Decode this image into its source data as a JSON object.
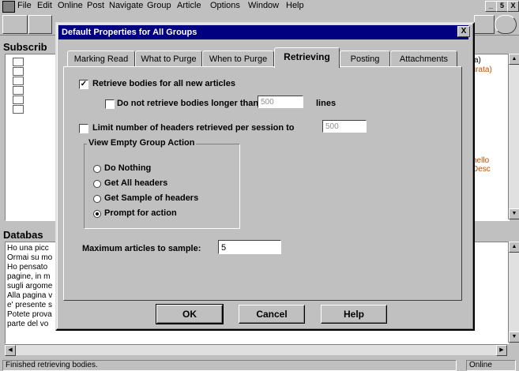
{
  "menu": [
    "File",
    "Edit",
    "Online",
    "Post",
    "Navigate",
    "Group",
    "Article",
    "Options",
    "Window",
    "Help"
  ],
  "window_controls": {
    "minimize": "_",
    "restore": "5",
    "close": "X"
  },
  "subscribe_pane": {
    "title": "Subscrib"
  },
  "right_fragments": {
    "a": "a)",
    "b": "irata)",
    "c": "hello Desc"
  },
  "database_pane": {
    "title": "Databas",
    "lines": [
      "Ho una picc",
      "Ormai su mo",
      "Ho pensato",
      "pagine, in m",
      "sugli argome",
      "Alla pagina v",
      "e' presente s",
      "Potete prova",
      "parte del vo"
    ]
  },
  "status": {
    "message": "Finished retrieving bodies.",
    "mode": "Online"
  },
  "dialog": {
    "title": "Default Properties for All Groups",
    "close": "X",
    "tabs": [
      "Marking Read",
      "What to Purge",
      "When to Purge",
      "Retrieving",
      "Posting",
      "Attachments"
    ],
    "active_tab": "Retrieving",
    "retrieve_bodies": {
      "label": "Retrieve bodies for all new articles",
      "checked": true
    },
    "no_retrieve_longer": {
      "label": "Do not retrieve bodies longer than",
      "value": "500",
      "suffix": "lines",
      "checked": false
    },
    "limit_headers": {
      "label": "Limit number of headers retrieved per session to",
      "value": "500",
      "checked": false
    },
    "empty_group_action": {
      "title": "View Empty Group Action",
      "options": [
        "Do Nothing",
        "Get All headers",
        "Get Sample of headers",
        "Prompt for action"
      ],
      "selected": "Prompt for action"
    },
    "max_sample": {
      "label": "Maximum articles to sample:",
      "value": "5"
    },
    "buttons": {
      "ok": "OK",
      "cancel": "Cancel",
      "help": "Help"
    }
  }
}
